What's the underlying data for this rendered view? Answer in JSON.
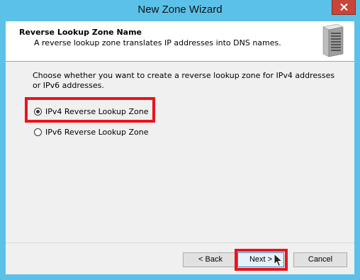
{
  "window": {
    "title": "New Zone Wizard"
  },
  "header": {
    "title": "Reverse Lookup Zone Name",
    "subtitle": "A reverse lookup zone translates IP addresses into DNS names."
  },
  "body": {
    "instruction": "Choose whether you want to create a reverse lookup zone for IPv4 addresses or IPv6 addresses.",
    "options": [
      {
        "label": "IPv4 Reverse Lookup Zone",
        "selected": true
      },
      {
        "label": "IPv6 Reverse Lookup Zone",
        "selected": false
      }
    ]
  },
  "buttons": {
    "back": "< Back",
    "next": "Next >",
    "cancel": "Cancel"
  },
  "colors": {
    "titlebar": "#5cc1e8",
    "highlight": "#e8141e",
    "close": "#c7463a"
  },
  "icons": [
    "server-icon",
    "close-icon",
    "cursor-icon"
  ]
}
